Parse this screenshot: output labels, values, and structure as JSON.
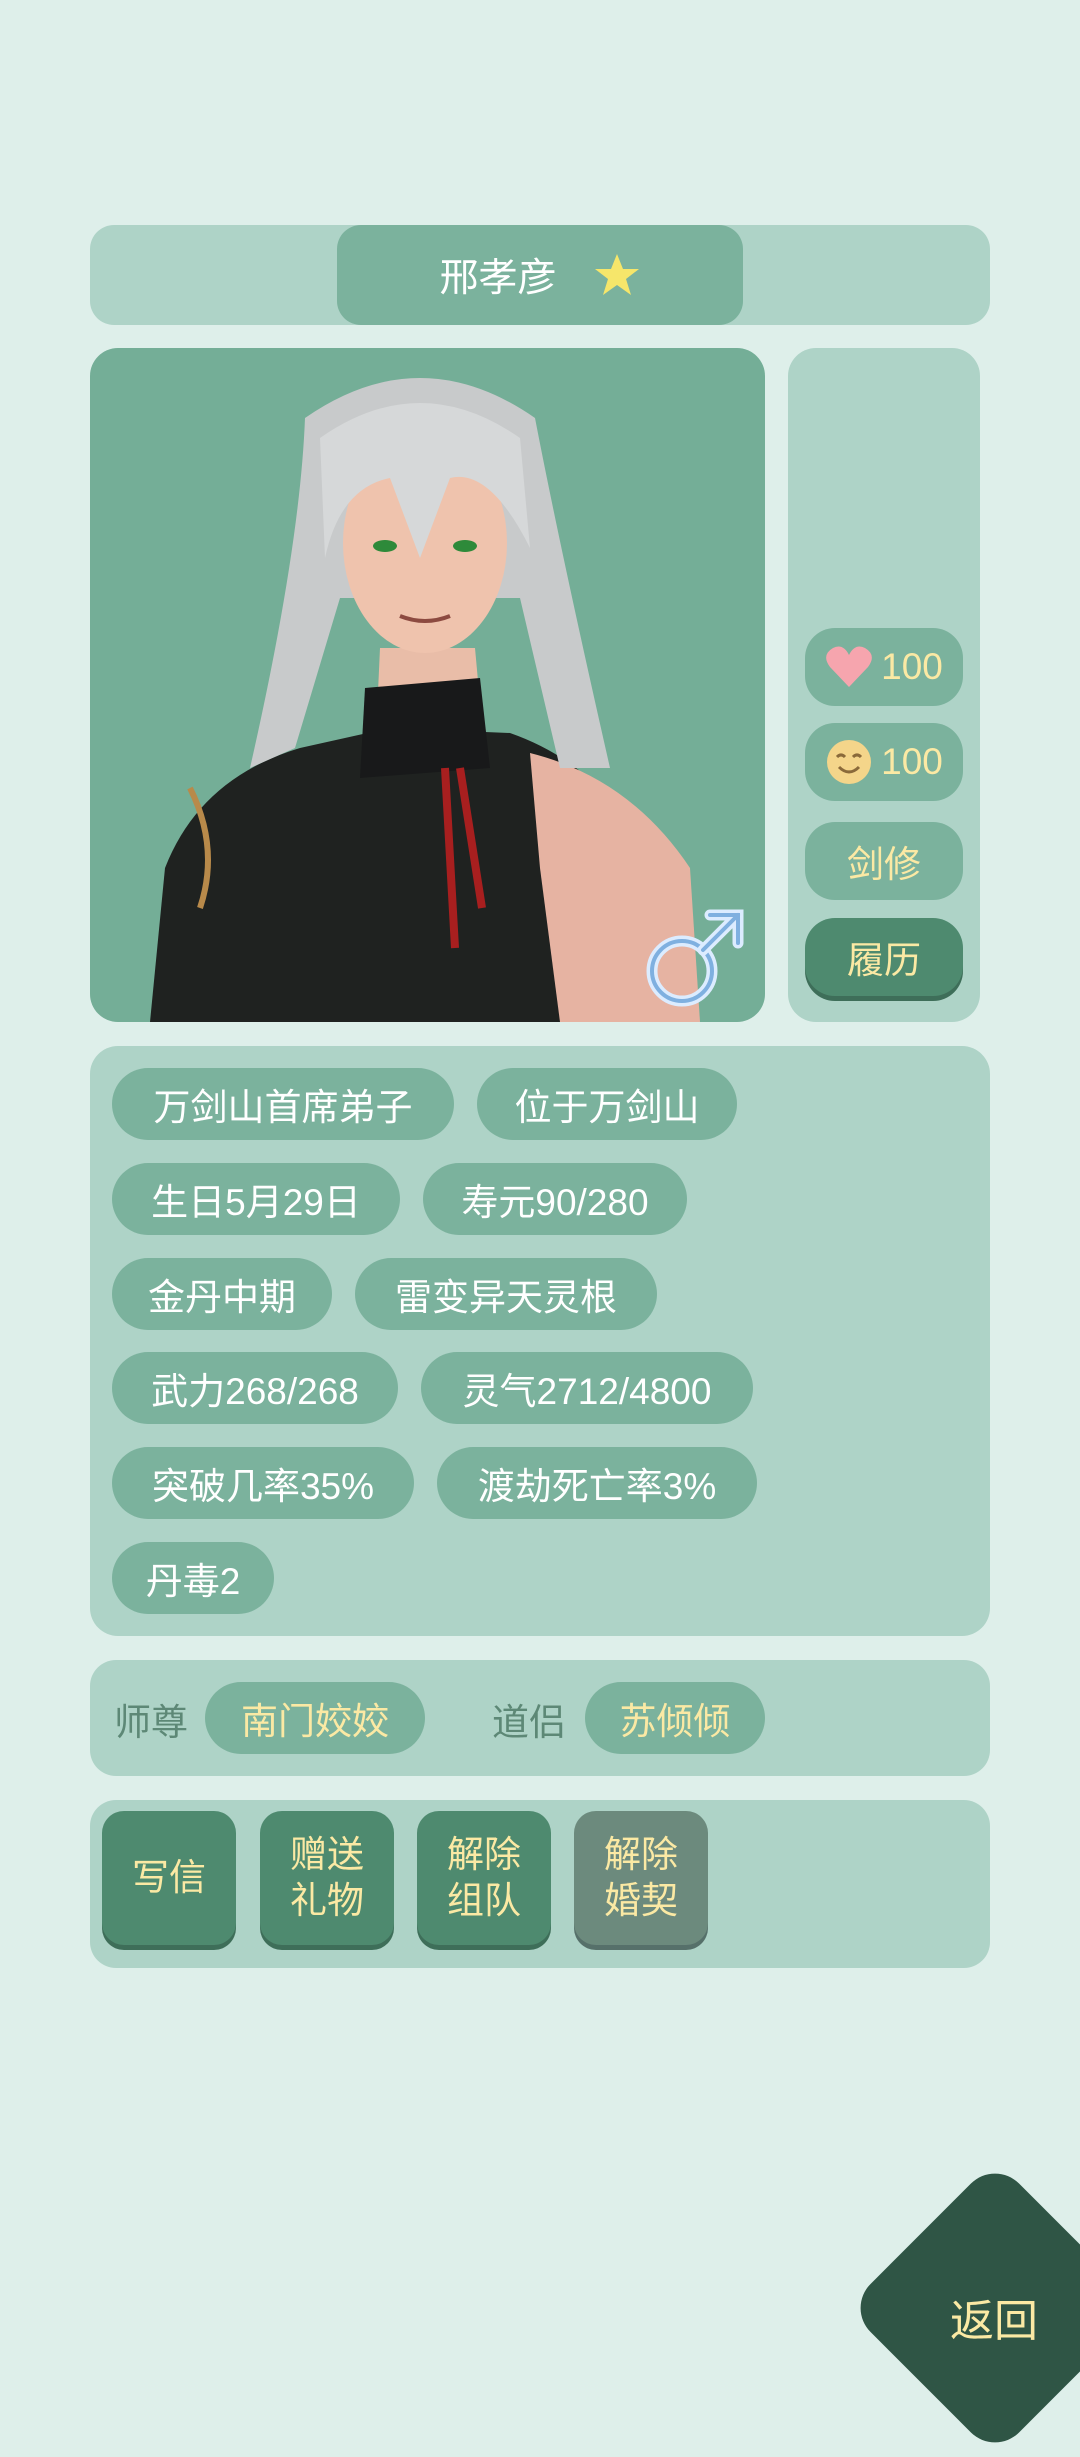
{
  "character": {
    "name": "邢孝彦"
  },
  "side": {
    "affection": "100",
    "mood": "100",
    "class_label": "剑修",
    "resume_label": "履历"
  },
  "info_tags": [
    "万剑山首席弟子",
    "位于万剑山",
    "生日5月29日",
    "寿元90/280",
    "金丹中期",
    "雷变异天灵根",
    "武力268/268",
    "灵气2712/4800",
    "突破几率35%",
    "渡劫死亡率3%",
    "丹毒2"
  ],
  "relations": {
    "master_label": "师尊",
    "master_name": "南门姣姣",
    "partner_label": "道侣",
    "partner_name": "苏倾倾"
  },
  "actions": {
    "write_letter": "写信",
    "gift_line1": "赠送",
    "gift_line2": "礼物",
    "leave_team_line1": "解除",
    "leave_team_line2": "组队",
    "divorce_line1": "解除",
    "divorce_line2": "婚契"
  },
  "back_label": "返回",
  "colors": {
    "background": "#deefea",
    "panel": "#aed3c7",
    "chip": "#7bb29d",
    "action_button": "#4e8a6f",
    "highlight_text": "#fbe9a4",
    "back_button": "#2f5545"
  }
}
